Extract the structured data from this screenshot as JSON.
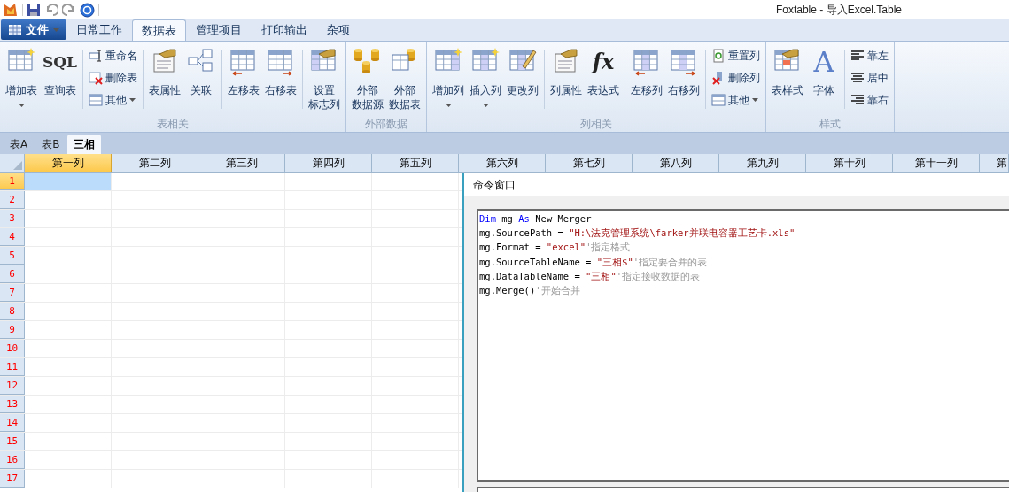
{
  "window": {
    "title": "Foxtable - 导入Excel.Table"
  },
  "file_button": {
    "label": "文件"
  },
  "tabs": [
    {
      "label": "日常工作",
      "selected": false
    },
    {
      "label": "数据表",
      "selected": true
    },
    {
      "label": "管理项目",
      "selected": false
    },
    {
      "label": "打印输出",
      "selected": false
    },
    {
      "label": "杂项",
      "selected": false
    }
  ],
  "ribbon_groups": [
    {
      "label": "表相关",
      "items": [
        {
          "kind": "large",
          "lines": [
            "增加表"
          ],
          "dropdown": true
        },
        {
          "kind": "large",
          "lines": [
            "查询表"
          ],
          "icon_text": "SQL",
          "dropdown": false
        },
        {
          "kind": "separator"
        },
        {
          "kind": "stack",
          "items": [
            {
              "label": "重命名",
              "dropdown": false
            },
            {
              "label": "删除表",
              "dropdown": false
            },
            {
              "label": "其他",
              "dropdown": true
            }
          ]
        },
        {
          "kind": "separator"
        },
        {
          "kind": "large",
          "lines": [
            "表属性"
          ],
          "dropdown": false
        },
        {
          "kind": "large",
          "lines": [
            "关联"
          ],
          "dropdown": false
        },
        {
          "kind": "separator"
        },
        {
          "kind": "large",
          "lines": [
            "左移表"
          ],
          "dropdown": false
        },
        {
          "kind": "large",
          "lines": [
            "右移表"
          ],
          "dropdown": false
        },
        {
          "kind": "separator"
        },
        {
          "kind": "large",
          "lines": [
            "设置",
            "标志列"
          ],
          "dropdown": false
        }
      ]
    },
    {
      "label": "外部数据",
      "items": [
        {
          "kind": "large",
          "lines": [
            "外部",
            "数据源"
          ],
          "dropdown": false
        },
        {
          "kind": "large",
          "lines": [
            "外部",
            "数据表"
          ],
          "dropdown": false
        }
      ]
    },
    {
      "label": "列相关",
      "items": [
        {
          "kind": "large",
          "lines": [
            "增加列"
          ],
          "dropdown": true
        },
        {
          "kind": "large",
          "lines": [
            "插入列"
          ],
          "dropdown": true
        },
        {
          "kind": "large",
          "lines": [
            "更改列"
          ],
          "dropdown": false
        },
        {
          "kind": "separator"
        },
        {
          "kind": "large",
          "lines": [
            "列属性"
          ],
          "dropdown": false
        },
        {
          "kind": "large",
          "lines": [
            "表达式"
          ],
          "icon_text": "fx",
          "dropdown": false
        },
        {
          "kind": "separator"
        },
        {
          "kind": "large",
          "lines": [
            "左移列"
          ],
          "dropdown": false
        },
        {
          "kind": "large",
          "lines": [
            "右移列"
          ],
          "dropdown": false
        },
        {
          "kind": "separator"
        },
        {
          "kind": "stack",
          "items": [
            {
              "label": "重置列",
              "dropdown": false
            },
            {
              "label": "删除列",
              "dropdown": false
            },
            {
              "label": "其他",
              "dropdown": true
            }
          ]
        }
      ]
    },
    {
      "label": "样式",
      "items": [
        {
          "kind": "large",
          "lines": [
            "表样式"
          ],
          "dropdown": false
        },
        {
          "kind": "large",
          "lines": [
            "字体"
          ],
          "icon_text": "A",
          "dropdown": false
        },
        {
          "kind": "separator"
        },
        {
          "kind": "stack",
          "items": [
            {
              "label": "靠左",
              "dropdown": false
            },
            {
              "label": "居中",
              "dropdown": false
            },
            {
              "label": "靠右",
              "dropdown": false
            }
          ]
        }
      ]
    }
  ],
  "sheet_tabs": [
    {
      "label": "表A",
      "selected": false
    },
    {
      "label": "表B",
      "selected": false
    },
    {
      "label": "三相",
      "selected": true
    }
  ],
  "grid": {
    "columns": [
      {
        "label": "第一列",
        "selected": true
      },
      {
        "label": "第二列",
        "selected": false
      },
      {
        "label": "第三列",
        "selected": false
      },
      {
        "label": "第四列",
        "selected": false
      },
      {
        "label": "第五列",
        "selected": false
      },
      {
        "label": "第六列",
        "selected": false
      },
      {
        "label": "第七列",
        "selected": false
      },
      {
        "label": "第八列",
        "selected": false
      },
      {
        "label": "第九列",
        "selected": false
      },
      {
        "label": "第十列",
        "selected": false
      },
      {
        "label": "第十一列",
        "selected": false
      },
      {
        "label": "第",
        "selected": false
      }
    ],
    "rows": [
      {
        "label": "1",
        "selected": true
      },
      {
        "label": "2",
        "selected": false
      },
      {
        "label": "3",
        "selected": false
      },
      {
        "label": "4",
        "selected": false
      },
      {
        "label": "5",
        "selected": false
      },
      {
        "label": "6",
        "selected": false
      },
      {
        "label": "7",
        "selected": false
      },
      {
        "label": "8",
        "selected": false
      },
      {
        "label": "9",
        "selected": false
      },
      {
        "label": "10",
        "selected": false
      },
      {
        "label": "11",
        "selected": false
      },
      {
        "label": "12",
        "selected": false
      },
      {
        "label": "13",
        "selected": false
      },
      {
        "label": "14",
        "selected": false
      },
      {
        "label": "15",
        "selected": false
      },
      {
        "label": "16",
        "selected": false
      },
      {
        "label": "17",
        "selected": false
      }
    ]
  },
  "command_window": {
    "title": "命令窗口",
    "code_lines": [
      [
        {
          "kind": "keyword",
          "text": "Dim"
        },
        {
          "kind": "plain",
          "text": " mg "
        },
        {
          "kind": "keyword",
          "text": "As"
        },
        {
          "kind": "plain",
          "text": " New Merger"
        }
      ],
      [
        {
          "kind": "plain",
          "text": "mg.SourcePath = "
        },
        {
          "kind": "string",
          "text": "\"H:\\法克管理系统\\farker并联电容器工艺卡.xls\""
        }
      ],
      [
        {
          "kind": "plain",
          "text": "mg.Format = "
        },
        {
          "kind": "string",
          "text": "\"excel\""
        },
        {
          "kind": "comment",
          "text": "'指定格式"
        }
      ],
      [
        {
          "kind": "plain",
          "text": "mg.SourceTableName = "
        },
        {
          "kind": "string",
          "text": "\"三相$\""
        },
        {
          "kind": "comment",
          "text": "'指定要合并的表"
        }
      ],
      [
        {
          "kind": "plain",
          "text": "mg.DataTableName = "
        },
        {
          "kind": "string",
          "text": "\"三相\""
        },
        {
          "kind": "comment",
          "text": "'指定接收数据的表"
        }
      ],
      [
        {
          "kind": "plain",
          "text": "mg.Merge()"
        },
        {
          "kind": "comment",
          "text": "'开始合并"
        }
      ]
    ]
  }
}
